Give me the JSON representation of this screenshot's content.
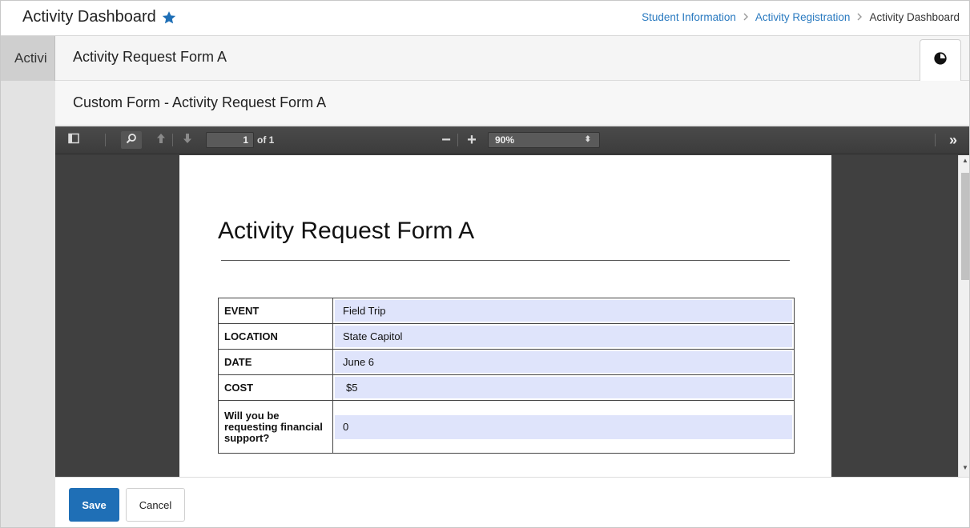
{
  "header": {
    "title": "Activity Dashboard",
    "breadcrumb": [
      "Student Information",
      "Activity Registration",
      "Activity Dashboard"
    ]
  },
  "background_tab": {
    "label": "Activi"
  },
  "panel": {
    "title": "Activity Request Form A",
    "subtitle": "Custom Form - Activity Request Form A"
  },
  "viewer": {
    "page_number": "1",
    "page_count": "of 1",
    "zoom": "90%",
    "zoom_minus": "−",
    "zoom_plus": "+",
    "more": "»"
  },
  "document": {
    "title": "Activity Request Form A",
    "rows": [
      {
        "label": "EVENT",
        "value": "Field Trip"
      },
      {
        "label": "LOCATION",
        "value": "State Capitol"
      },
      {
        "label": "DATE",
        "value": "June 6"
      },
      {
        "label": "COST",
        "value": "$5"
      },
      {
        "label": "Will you be requesting financial support?",
        "value": "0"
      }
    ]
  },
  "footer": {
    "save_label": "Save",
    "cancel_label": "Cancel"
  },
  "colors": {
    "accent": "#2a7ac0",
    "save_button": "#1f6fb6",
    "field_fill": "#dfe4fb",
    "star": "#1f6fb6"
  },
  "icons": [
    "star-icon",
    "chevron-right-icon",
    "sidebar-toggle-icon",
    "search-icon",
    "arrow-up-icon",
    "arrow-down-icon",
    "tools-icon",
    "panel-action-icon"
  ]
}
